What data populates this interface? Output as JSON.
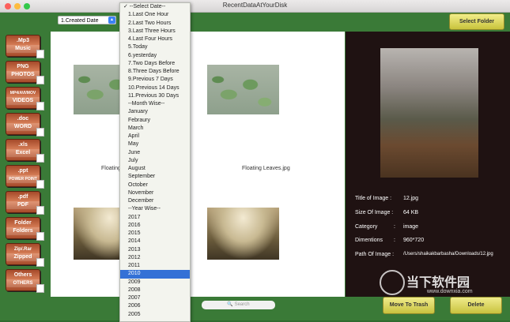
{
  "window": {
    "title": "RecentDataAtYourDisk"
  },
  "toolbar": {
    "date_filter": "1.Created Date",
    "select_folder": "Select Folder"
  },
  "categories": [
    {
      "top": ".Mp3",
      "bottom": "Music"
    },
    {
      "top": "PNG",
      "bottom": "PHOTOS"
    },
    {
      "top": "MP4/AVI/MOV",
      "bottom": "VIDEOS"
    },
    {
      "top": ".doc",
      "bottom": "WORD"
    },
    {
      "top": ".xls",
      "bottom": "Excel"
    },
    {
      "top": ".ppt",
      "bottom": "POWER POINT"
    },
    {
      "top": ".pdf",
      "bottom": "PDF"
    },
    {
      "top": "Folder",
      "bottom": "Folders"
    },
    {
      "top": "Zip/.Rar",
      "bottom": "Zipped"
    },
    {
      "top": "Others",
      "bottom": "OTHERS"
    }
  ],
  "grid": {
    "items": [
      {
        "caption": "Floating Leaves.jpg"
      },
      {
        "caption": "Floating Leaves.jpg"
      },
      {
        "caption": ""
      },
      {
        "caption": ""
      }
    ]
  },
  "search": {
    "placeholder": "Search"
  },
  "details": {
    "title_label": "Title of Image :",
    "title_value": "12.jpg",
    "size_label": "Size Of Image :",
    "size_value": "64 KB",
    "category_label": "Category",
    "category_sep": ":",
    "category_value": "image",
    "dimensions_label": "Dimentions",
    "dimensions_sep": ":",
    "dimensions_value": "960*720",
    "path_label": "Path Of Image :",
    "path_value": "/Users/shaikakbarbasha/Downloads/12.jpg"
  },
  "actions": {
    "trash": "Move To Trash",
    "delete": "Delete"
  },
  "dropdown": {
    "options": [
      "✓ --Select Date--",
      "1.Last One Hour",
      "2.Last Two Hours",
      "3.Last Three Hours",
      "4.Last Four Hours",
      "5.Today",
      "6.yesterday",
      "7.Two Days Before",
      "8.Three Days Before",
      "9.Previous 7 Days",
      "10.Previous 14 Days",
      "11.Previous 30 Days",
      "--Month Wise--",
      "January",
      "Febraury",
      "March",
      "April",
      "May",
      "June",
      "July",
      "August",
      "September",
      "October",
      "November",
      "December",
      "--Year Wise--",
      "2017",
      "2016",
      "2015",
      "2014",
      "2013",
      "2012",
      "2011",
      "2010",
      "2009",
      "2008",
      "2007",
      "2006",
      "2005"
    ],
    "selected_index": 33
  },
  "watermark": {
    "text": "当下软件园",
    "url": "www.downxia.com"
  },
  "colors": {
    "window_bg": "#3a7a37",
    "selection": "#3471d6",
    "button": "#e6e06a"
  }
}
